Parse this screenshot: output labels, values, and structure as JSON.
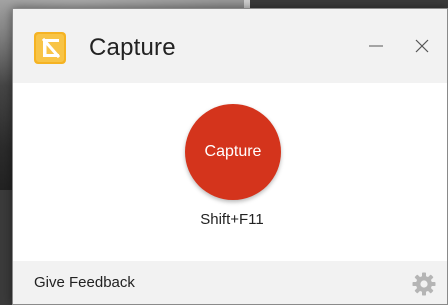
{
  "window": {
    "title": "Capture",
    "logo_icon": "capture-app-logo-icon",
    "controls": {
      "minimize_icon": "minimize-icon",
      "close_icon": "close-icon"
    }
  },
  "main": {
    "capture_button_label": "Capture",
    "shortcut": "Shift+F11"
  },
  "footer": {
    "feedback_label": "Give Feedback",
    "settings_icon": "gear-icon"
  },
  "colors": {
    "capture_button": "#d4341c",
    "logo_yellow": "#f5b323",
    "title_bar": "#f2f2f2",
    "footer": "#f2f2f2"
  }
}
